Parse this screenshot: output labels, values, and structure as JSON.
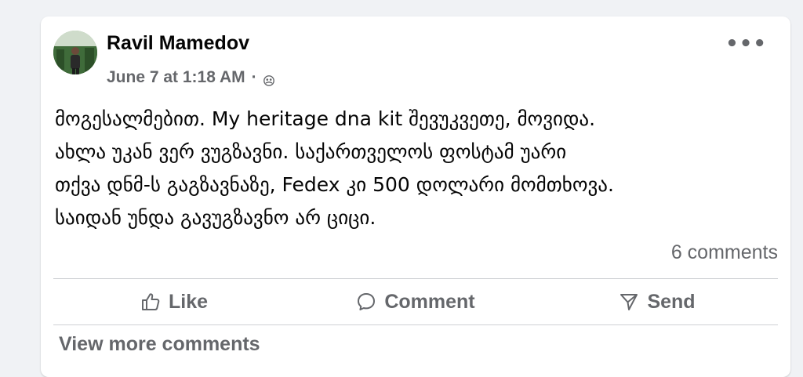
{
  "post": {
    "author": "Ravil Mamedov",
    "timestamp": "June 7 at 1:18 AM",
    "separator": "·",
    "privacy_icon": "friends-icon",
    "more_label": "•••",
    "text": "მოგესალმებით. My heritage dna kit შევუკვეთე, მოვიდა.\nახლა უკან ვერ ვუგზავნი. საქართველოს ფოსტამ უარი\nთქვა დნმ-ს გაგზავნაზე, Fedex კი 500 დოლარი მომთხოვა.\nსაიდან უნდა გავუგზავნო არ ციცი.",
    "comments_count": "6 comments"
  },
  "actions": {
    "like": "Like",
    "comment": "Comment",
    "send": "Send"
  },
  "view_more": "View more comments",
  "colors": {
    "background": "#f0f2f5",
    "card": "#ffffff",
    "secondary_text": "#65676b",
    "divider": "#ced0d4"
  }
}
